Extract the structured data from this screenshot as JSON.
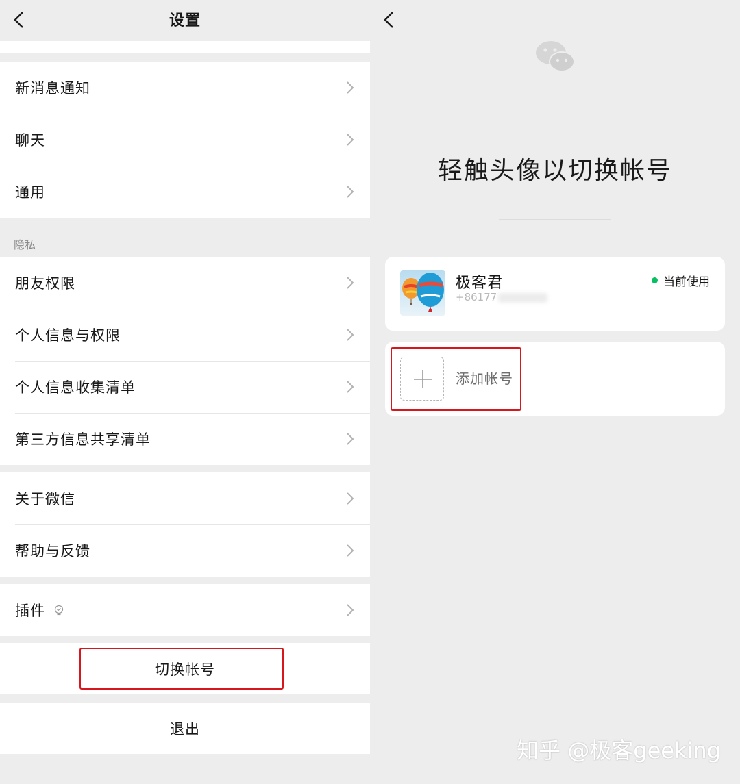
{
  "settings": {
    "title": "设置",
    "section_privacy_label": "隐私",
    "group1": [
      {
        "label": "新消息通知"
      },
      {
        "label": "聊天"
      },
      {
        "label": "通用"
      }
    ],
    "group2": [
      {
        "label": "朋友权限"
      },
      {
        "label": "个人信息与权限"
      },
      {
        "label": "个人信息收集清单"
      },
      {
        "label": "第三方信息共享清单"
      }
    ],
    "group3": [
      {
        "label": "关于微信"
      },
      {
        "label": "帮助与反馈"
      }
    ],
    "plugins_label": "插件",
    "switch_account_label": "切换帐号",
    "logout_label": "退出"
  },
  "switcher": {
    "title": "轻触头像以切换帐号",
    "account": {
      "name": "极客君",
      "phone_visible": "+86177",
      "status": "当前使用",
      "status_color": "#07c160"
    },
    "add_account_label": "添加帐号"
  },
  "watermark": "知乎 @极客geeking",
  "colors": {
    "highlight": "#d7161d",
    "background": "#ededed",
    "card": "#ffffff"
  }
}
